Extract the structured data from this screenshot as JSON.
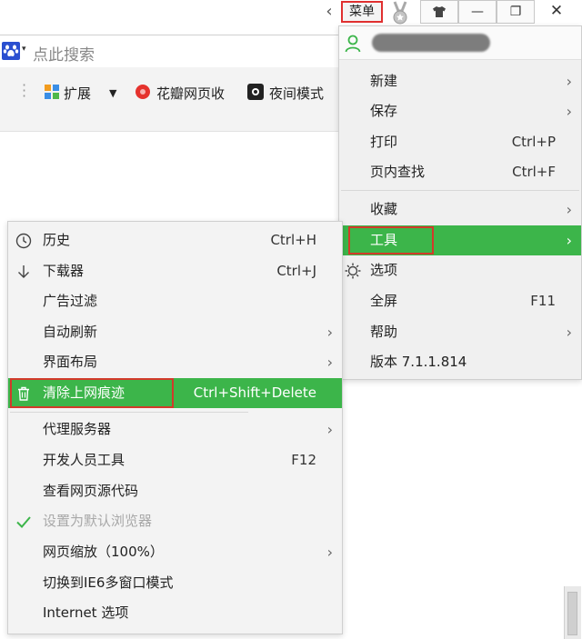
{
  "titlebar": {
    "back_icon": "chevron-left-icon",
    "menu_label": "菜单",
    "skin_icon": "medal-icon",
    "shirt_icon": "tshirt-icon",
    "minimize": "—",
    "maximize": "❐",
    "close": "✕"
  },
  "addressbar": {
    "search_placeholder": "点此搜索",
    "engine_icon": "baidu-paw-icon"
  },
  "toolbar": {
    "items": [
      {
        "label": "扩展",
        "icon": "extension-grid-icon"
      },
      {
        "label": "花瓣网页收",
        "icon": "huaban-icon"
      },
      {
        "label": "夜间模式",
        "icon": "night-mode-icon"
      }
    ]
  },
  "main_menu": {
    "items": [
      {
        "label": "新建",
        "shortcut": "",
        "arrow": "›"
      },
      {
        "label": "保存",
        "shortcut": "",
        "arrow": "›"
      },
      {
        "label": "打印",
        "shortcut": "Ctrl+P",
        "arrow": ""
      },
      {
        "label": "页内查找",
        "shortcut": "Ctrl+F",
        "arrow": ""
      },
      {
        "label": "收藏",
        "shortcut": "",
        "arrow": "›"
      },
      {
        "label": "工具",
        "shortcut": "",
        "arrow": "›"
      },
      {
        "label": "选项",
        "shortcut": "",
        "arrow": ""
      },
      {
        "label": "全屏",
        "shortcut": "F11",
        "arrow": ""
      },
      {
        "label": "帮助",
        "shortcut": "",
        "arrow": "›"
      },
      {
        "label": "版本 7.1.1.814",
        "shortcut": "",
        "arrow": ""
      }
    ]
  },
  "tools_submenu": {
    "items": [
      {
        "label": "历史",
        "shortcut": "Ctrl+H",
        "arrow": ""
      },
      {
        "label": "下载器",
        "shortcut": "Ctrl+J",
        "arrow": ""
      },
      {
        "label": "广告过滤",
        "shortcut": "",
        "arrow": ""
      },
      {
        "label": "自动刷新",
        "shortcut": "",
        "arrow": "›"
      },
      {
        "label": "界面布局",
        "shortcut": "",
        "arrow": "›"
      },
      {
        "label": "清除上网痕迹",
        "shortcut": "Ctrl+Shift+Delete",
        "arrow": ""
      },
      {
        "label": "代理服务器",
        "shortcut": "",
        "arrow": "›"
      },
      {
        "label": "开发人员工具",
        "shortcut": "F12",
        "arrow": ""
      },
      {
        "label": "查看网页源代码",
        "shortcut": "",
        "arrow": ""
      },
      {
        "label": "设置为默认浏览器",
        "shortcut": "",
        "arrow": ""
      },
      {
        "label": "网页缩放（100%）",
        "shortcut": "",
        "arrow": "›"
      },
      {
        "label": "切换到IE6多窗口模式",
        "shortcut": "",
        "arrow": ""
      },
      {
        "label": "Internet 选项",
        "shortcut": "",
        "arrow": ""
      }
    ]
  },
  "colors": {
    "highlight_green": "#3cb54a",
    "annotation_red": "#d23a2a",
    "user_icon_green": "#3cb54a"
  }
}
